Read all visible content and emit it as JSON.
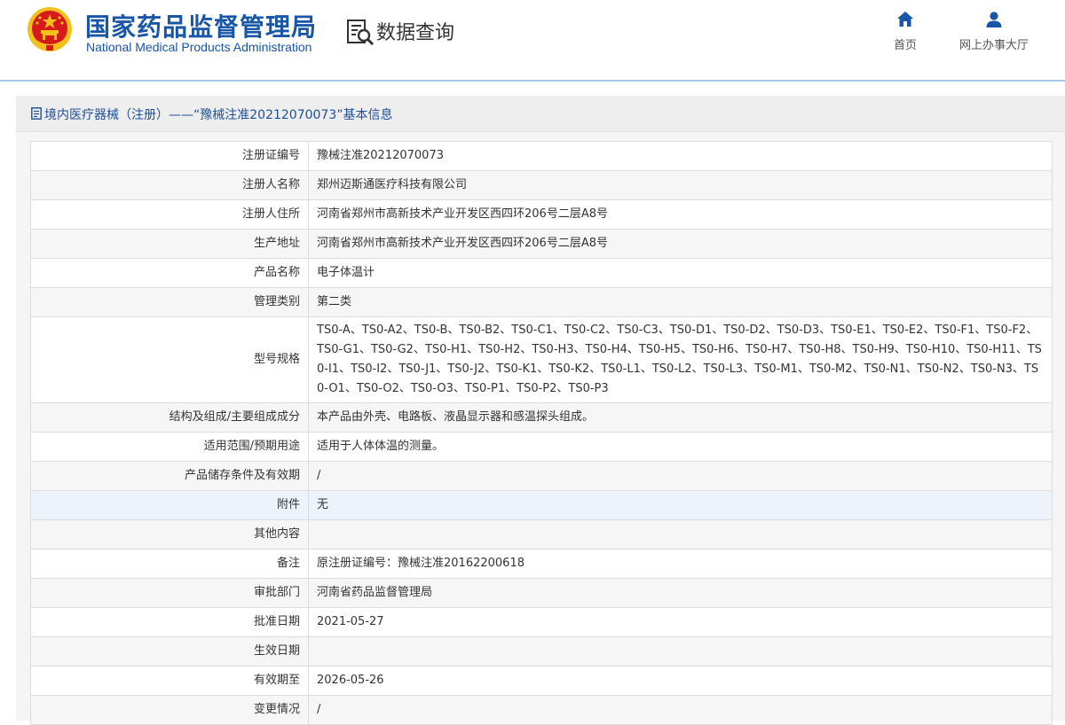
{
  "header": {
    "org_name_cn": "国家药品监督管理局",
    "org_name_en": "National Medical Products Administration",
    "page_title": "数据查询",
    "nav": [
      {
        "label": "首页",
        "icon": "home-icon"
      },
      {
        "label": "网上办事大厅",
        "icon": "user-icon"
      }
    ]
  },
  "panel": {
    "title": "境内医疗器械（注册）——“豫械注准20212070073”基本信息"
  },
  "rows": [
    {
      "label": "注册证编号",
      "value": "豫械注准20212070073"
    },
    {
      "label": "注册人名称",
      "value": "郑州迈斯通医疗科技有限公司"
    },
    {
      "label": "注册人住所",
      "value": "河南省郑州市高新技术产业开发区西四环206号二层A8号"
    },
    {
      "label": "生产地址",
      "value": "河南省郑州市高新技术产业开发区西四环206号二层A8号"
    },
    {
      "label": "产品名称",
      "value": "电子体温计"
    },
    {
      "label": "管理类别",
      "value": "第二类"
    },
    {
      "label": "型号规格",
      "value": "TS0-A、TS0-A2、TS0-B、TS0-B2、TS0-C1、TS0-C2、TS0-C3、TS0-D1、TS0-D2、TS0-D3、TS0-E1、TS0-E2、TS0-F1、TS0-F2、TS0-G1、TS0-G2、TS0-H1、TS0-H2、TS0-H3、TS0-H4、TS0-H5、TS0-H6、TS0-H7、TS0-H8、TS0-H9、TS0-H10、TS0-H11、TS0-I1、TS0-I2、TS0-J1、TS0-J2、TS0-K1、TS0-K2、TS0-L1、TS0-L2、TS0-L3、TS0-M1、TS0-M2、TS0-N1、TS0-N2、TS0-N3、TS0-O1、TS0-O2、TS0-O3、TS0-P1、TS0-P2、TS0-P3"
    },
    {
      "label": "结构及组成/主要组成成分",
      "value": "本产品由外壳、电路板、液晶显示器和感温探头组成。"
    },
    {
      "label": "适用范围/预期用途",
      "value": "适用于人体体温的测量。"
    },
    {
      "label": "产品储存条件及有效期",
      "value": "/"
    },
    {
      "label": "附件",
      "value": "无"
    },
    {
      "label": "其他内容",
      "value": ""
    },
    {
      "label": "备注",
      "value": "原注册证编号：豫械注准20162200618"
    },
    {
      "label": "审批部门",
      "value": "河南省药品监督管理局"
    },
    {
      "label": "批准日期",
      "value": "2021-05-27"
    },
    {
      "label": "生效日期",
      "value": ""
    },
    {
      "label": "有效期至",
      "value": "2026-05-26"
    },
    {
      "label": "变更情况",
      "value": "/"
    }
  ],
  "colors": {
    "brand_blue": "#1856a8",
    "title_blue": "#1f4e96",
    "header_line": "#a9c6e8",
    "emblem_red": "#d7191b",
    "emblem_gold": "#f3c11b"
  }
}
